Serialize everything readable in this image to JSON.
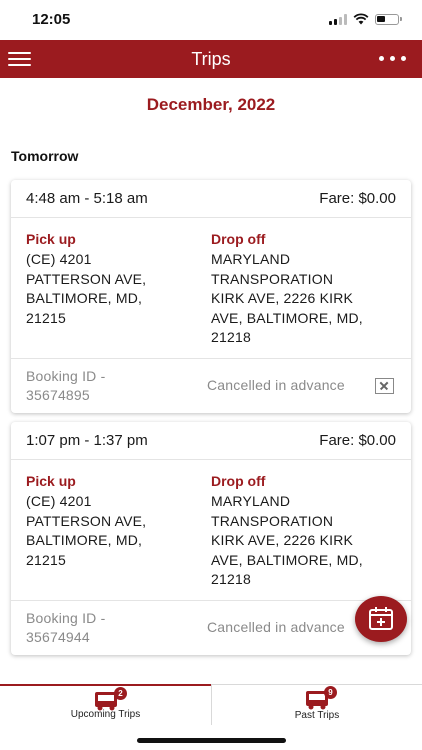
{
  "status_bar": {
    "time": "12:05"
  },
  "nav": {
    "title": "Trips"
  },
  "month": "December, 2022",
  "day": "Tomorrow",
  "trips": [
    {
      "time": "4:48 am - 5:18 am",
      "fare": "Fare: $0.00",
      "pickup_label": "Pick up",
      "pickup_lines": [
        "(CE) 4201",
        "PATTERSON AVE,",
        "BALTIMORE, MD,",
        "21215"
      ],
      "dropoff_label": "Drop off",
      "dropoff_lines": [
        "MARYLAND",
        "TRANSPORATION",
        "KIRK AVE, 2226 KIRK",
        "AVE, BALTIMORE, MD,",
        "21218"
      ],
      "booking_lines": [
        "Booking ID -",
        "35674895"
      ],
      "status": "Cancelled in advance"
    },
    {
      "time": "1:07 pm - 1:37 pm",
      "fare": "Fare: $0.00",
      "pickup_label": "Pick up",
      "pickup_lines": [
        "(CE) 4201",
        "PATTERSON AVE,",
        "BALTIMORE, MD,",
        "21215"
      ],
      "dropoff_label": "Drop off",
      "dropoff_lines": [
        "MARYLAND",
        "TRANSPORATION",
        "KIRK AVE, 2226 KIRK",
        "AVE, BALTIMORE, MD,",
        "21218"
      ],
      "booking_lines": [
        "Booking ID -",
        "35674944"
      ],
      "status": "Cancelled in advance"
    }
  ],
  "tabs": {
    "upcoming": {
      "label": "Upcoming Trips",
      "badge": "2"
    },
    "past": {
      "label": "Past Trips",
      "badge": "9"
    }
  },
  "colors": {
    "brand": "#9b1b1f",
    "muted_text": "#8a8a8a"
  }
}
